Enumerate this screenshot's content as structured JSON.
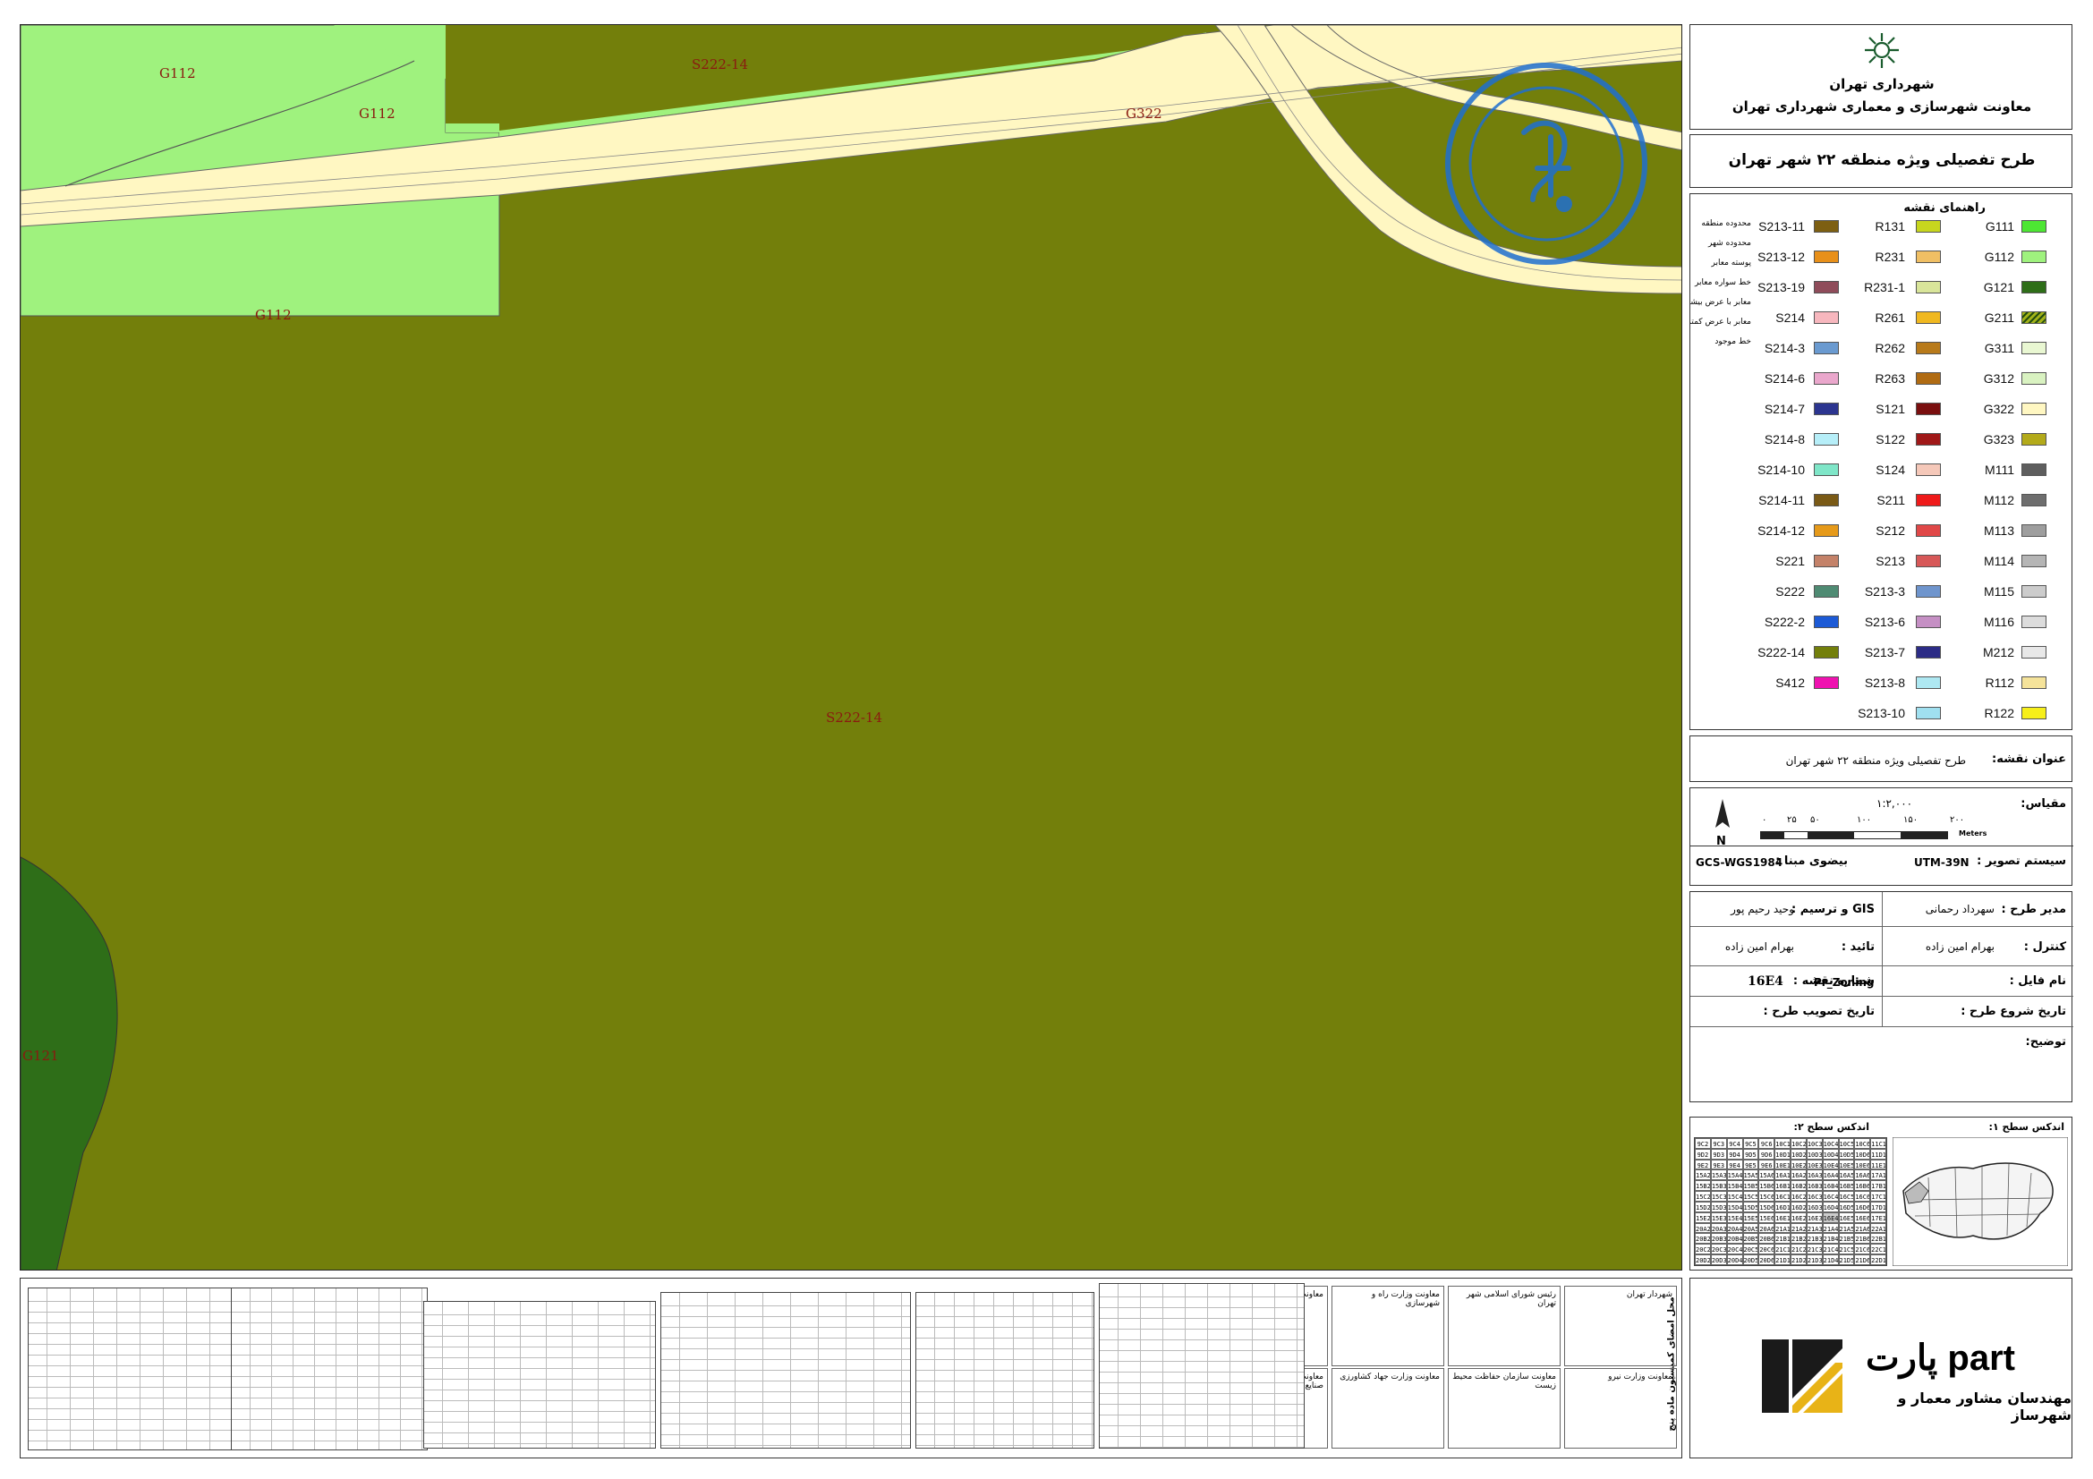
{
  "map": {
    "zone_labels": {
      "g112_a": "G112",
      "g112_b": "G112",
      "g112_c": "G112",
      "s222_top": "S222-14",
      "s222_center": "S222-14",
      "g322": "G322",
      "g121": "G121"
    },
    "colors": {
      "s222_14": "#737f0b",
      "g112": "#9ff27e",
      "g322": "#fff7c2",
      "g121": "#2e6e18",
      "stamp": "#1f6fd0"
    }
  },
  "header": {
    "org_name": "شهرداری تهران",
    "org_deputy": "معاونت شهرسازی و معماری شهرداری تهران",
    "plan_title": "طرح تفصیلی ویژه منطقه ۲۲ شهر تهران"
  },
  "legend": {
    "title": "راهنمای نقشه",
    "col1": [
      {
        "code": "G111",
        "color": "#4de633"
      },
      {
        "code": "G112",
        "color": "#9ff27e"
      },
      {
        "code": "G121",
        "color": "#2e6e18"
      },
      {
        "code": "G211",
        "color": "#a3b319",
        "icon": "hatch"
      },
      {
        "code": "G311",
        "color": "#e9f7d2"
      },
      {
        "code": "G312",
        "color": "#d9f2c1"
      },
      {
        "code": "G322",
        "color": "#fff7c2"
      },
      {
        "code": "G323",
        "color": "#b3aa1a"
      },
      {
        "code": "M111",
        "color": "#5e5e5e"
      },
      {
        "code": "M112",
        "color": "#6e6e6e"
      },
      {
        "code": "M113",
        "color": "#9e9e9e"
      },
      {
        "code": "M114",
        "color": "#b5b5b5"
      },
      {
        "code": "M115",
        "color": "#cccccc"
      },
      {
        "code": "M116",
        "color": "#dcdcdc"
      },
      {
        "code": "M212",
        "color": "#e8e8e8"
      },
      {
        "code": "R112",
        "color": "#f5e39a"
      },
      {
        "code": "R122",
        "color": "#f7ef1a"
      }
    ],
    "col2": [
      {
        "code": "R131",
        "color": "#c7d61e"
      },
      {
        "code": "R231",
        "color": "#f0bf64"
      },
      {
        "code": "R231-1",
        "color": "#d9e59a"
      },
      {
        "code": "R261",
        "color": "#f0b820"
      },
      {
        "code": "R262",
        "color": "#b87a1a"
      },
      {
        "code": "R263",
        "color": "#b06b12"
      },
      {
        "code": "S121",
        "color": "#7a0f0f"
      },
      {
        "code": "S122",
        "color": "#a01818"
      },
      {
        "code": "S124",
        "color": "#f5c8b9"
      },
      {
        "code": "S211",
        "color": "#ef1a1a"
      },
      {
        "code": "S212",
        "color": "#e04848"
      },
      {
        "code": "S213",
        "color": "#d75858"
      },
      {
        "code": "S213-3",
        "color": "#6f95cd"
      },
      {
        "code": "S213-6",
        "color": "#c58fc4"
      },
      {
        "code": "S213-7",
        "color": "#2c2c86"
      },
      {
        "code": "S213-8",
        "color": "#aee8f2"
      },
      {
        "code": "S213-10",
        "color": "#a0e0f0"
      }
    ],
    "col3": [
      {
        "code": "S213-11",
        "color": "#7d5f12"
      },
      {
        "code": "S213-12",
        "color": "#e8901a"
      },
      {
        "code": "S213-19",
        "color": "#8f4c5a"
      },
      {
        "code": "S214",
        "color": "#f7b7be"
      },
      {
        "code": "S214-3",
        "color": "#6a9ad0"
      },
      {
        "code": "S214-6",
        "color": "#eaa7cc"
      },
      {
        "code": "S214-7",
        "color": "#2c3590"
      },
      {
        "code": "S214-8",
        "color": "#b6eef8"
      },
      {
        "code": "S214-10",
        "color": "#7fe6c8"
      },
      {
        "code": "S214-11",
        "color": "#7a5a16"
      },
      {
        "code": "S214-12",
        "color": "#e69a1a"
      },
      {
        "code": "S221",
        "color": "#c48269"
      },
      {
        "code": "S222",
        "color": "#4f8b73"
      },
      {
        "code": "S222-2",
        "color": "#1c5ad6"
      },
      {
        "code": "S222-14",
        "color": "#737f0b"
      },
      {
        "code": "S412",
        "color": "#ef12b0"
      }
    ],
    "lines": [
      "محدوده منطقه",
      "محدوده شهر",
      "پوسته معابر",
      "خط سواره معابر",
      "معابر با عرض بیشتر از ۳۰ متر",
      "معابر با عرض کمتر از ۳۰ متر",
      "خط موجود"
    ]
  },
  "info": {
    "map_title_label": "عنوان نقشه:",
    "map_title_value": "طرح تفصیلی ویژه منطقه ۲۲ شهر تهران",
    "scale_label": "مقیاس:",
    "scale_value": "۱:۲,۰۰۰",
    "scale_ticks": [
      "۲۰۰",
      "۱۵۰",
      "۱۰۰",
      "۵۰",
      "۲۵",
      "۰"
    ],
    "scale_unit": "Meters",
    "north": "N",
    "projection_label": "سیستم تصویر :",
    "projection_value": "UTM-39N",
    "datum_label": "بیضوی مبنا :",
    "datum_value": "GCS-WGS1984",
    "manager_label": "مدیر طرح :",
    "manager_value": "سهرداد رحمانی",
    "gis_label": "GIS و ترسیم :",
    "gis_value": "وحید رحیم پور",
    "control_label": "کنترل :",
    "control_value": "بهرام امین زاده",
    "approve_label": "تائید :",
    "approve_value": "بهرام امین زاده",
    "file_label": "نام فایل :",
    "file_value": "Pr_Zoning",
    "sheet_label": "شماره نقشه :",
    "sheet_value": "16E4",
    "start_label": "تاریخ شروع طرح :",
    "approval_label": "تاریخ تصویب طرح :",
    "desc_label": "توضیح:"
  },
  "index": {
    "level1_label": "اندکس سطح ۱:",
    "level2_label": "اندکس سطح ۲:",
    "cells": [
      "9C2",
      "9C3",
      "9C4",
      "9C5",
      "9C6",
      "10C1",
      "10C2",
      "10C3",
      "10C4",
      "10C5",
      "10C6",
      "11C1",
      "9D2",
      "9D3",
      "9D4",
      "9D5",
      "9D6",
      "10D1",
      "10D2",
      "10D3",
      "10D4",
      "10D5",
      "10D6",
      "11D1",
      "9E2",
      "9E3",
      "9E4",
      "9E5",
      "9E6",
      "10E1",
      "10E2",
      "10E3",
      "10E4",
      "10E5",
      "10E6",
      "11E1",
      "15A2",
      "15A3",
      "15A4",
      "15A5",
      "15A6",
      "16A1",
      "16A2",
      "16A3",
      "16A4",
      "16A5",
      "16A6",
      "17A1",
      "15B2",
      "15B3",
      "15B4",
      "15B5",
      "15B6",
      "16B1",
      "16B2",
      "16B3",
      "16B4",
      "16B5",
      "16B6",
      "17B1",
      "15C2",
      "15C3",
      "15C4",
      "15C5",
      "15C6",
      "16C1",
      "16C2",
      "16C3",
      "16C4",
      "16C5",
      "16C6",
      "17C1",
      "15D2",
      "15D3",
      "15D4",
      "15D5",
      "15D6",
      "16D1",
      "16D2",
      "16D3",
      "16D4",
      "16D5",
      "16D6",
      "17D1",
      "15E2",
      "15E3",
      "15E4",
      "15E5",
      "15E6",
      "16E1",
      "16E2",
      "16E3",
      "16E4",
      "16E5",
      "16E6",
      "17E1",
      "20A2",
      "20A3",
      "20A4",
      "20A5",
      "20A6",
      "21A1",
      "21A2",
      "21A3",
      "21A4",
      "21A5",
      "21A6",
      "22A1",
      "20B2",
      "20B3",
      "20B4",
      "20B5",
      "20B6",
      "21B1",
      "21B2",
      "21B3",
      "21B4",
      "21B5",
      "21B6",
      "22B1",
      "20C2",
      "20C3",
      "20C4",
      "20C5",
      "20C6",
      "21C1",
      "21C2",
      "21C3",
      "21C4",
      "21C5",
      "21C6",
      "22C1",
      "20D2",
      "20D3",
      "20D4",
      "20D5",
      "20D6",
      "21D1",
      "21D2",
      "21D3",
      "21D4",
      "21D5",
      "21D6",
      "22D1"
    ]
  },
  "approvals": {
    "cells": [
      "شهردار تهران",
      "رئیس شورای اسلامی شهر تهران",
      "معاونت وزارت راه و شهرسازی",
      "معاونت وزارت کشور",
      "معاونت وزارت نیرو",
      "معاونت سازمان حفاظت محیط زیست",
      "معاونت وزارت جهاد کشاورزی",
      "معاونت وزارت میراث فرهنگی صنایع دستی و گردشگری"
    ],
    "commission_title": "محل امضای کمیسیون ماده پنج"
  },
  "firm": {
    "logo_text": "پارت part",
    "name": "مهندسان مشاور معمار و شهرساز"
  }
}
